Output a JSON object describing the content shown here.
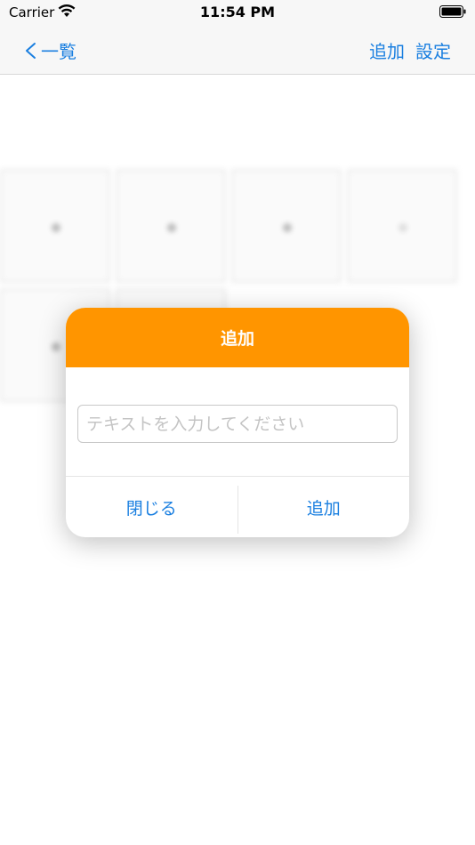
{
  "status_bar": {
    "carrier": "Carrier",
    "time": "11:54 PM",
    "wifi_icon": "wifi-icon",
    "battery_icon": "battery-icon"
  },
  "nav_bar": {
    "back_label": "一覧",
    "back_icon": "chevron-left-icon",
    "add_label": "追加",
    "settings_label": "設定"
  },
  "dialog": {
    "title": "追加",
    "input_value": "",
    "input_placeholder": "テキストを入力してください",
    "close_label": "閉じる",
    "add_label": "追加"
  },
  "colors": {
    "accent_blue": "#1a7fe0",
    "header_orange": "#ff9500",
    "nav_background": "#f7f7f7"
  }
}
